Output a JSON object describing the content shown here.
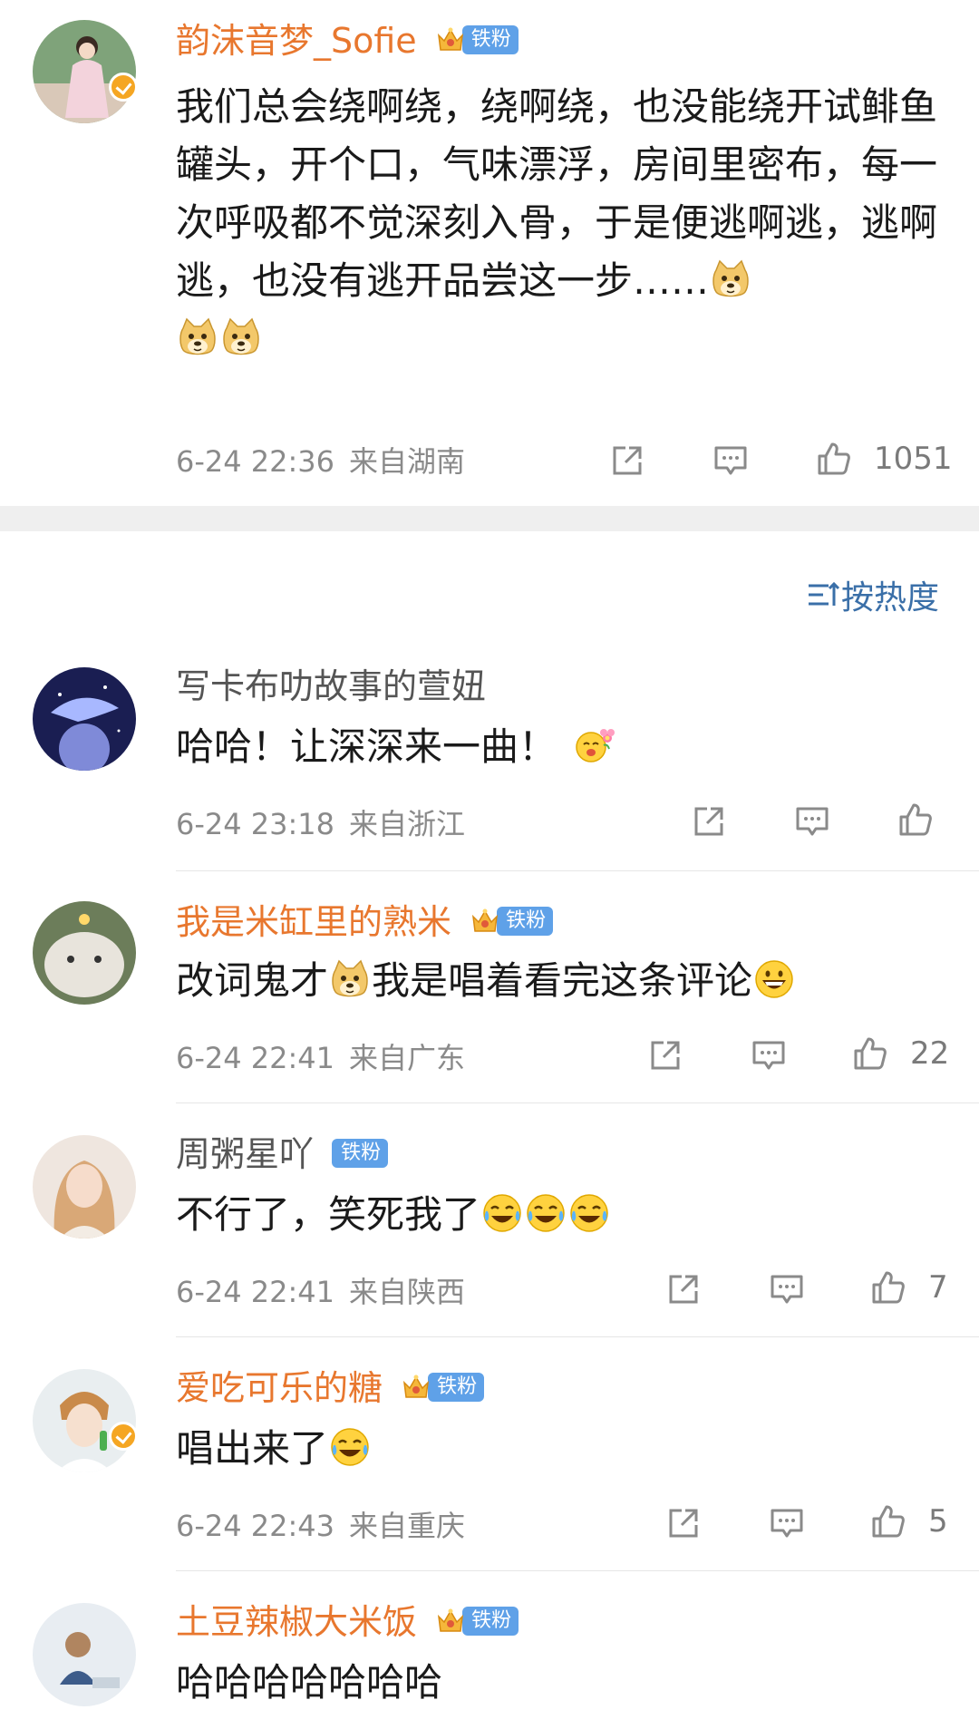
{
  "top_comment": {
    "username": "韵沫音梦_Sofie",
    "badge": "铁粉",
    "text": "我们总会绕啊绕，绕啊绕，也没能绕开试鲱鱼罐头，开个口，气味漂浮，房间里密布，每一次呼吸都不觉深刻入骨，于是便逃啊逃，逃啊逃，也没有逃开品尝这一步……",
    "time": "6-24 22:36",
    "location": "来自湖南",
    "likes": "1051"
  },
  "sort_label": "按热度",
  "replies": [
    {
      "username": "写卡布叻故事的萱妞",
      "name_color": "gray",
      "badge": "",
      "text": "哈哈！让深深来一曲！",
      "time": "6-24 23:18",
      "location": "来自浙江",
      "likes": ""
    },
    {
      "username": "我是米缸里的熟米",
      "name_color": "orange",
      "badge": "铁粉",
      "text_a": "改词鬼才",
      "text_b": "我是唱着看完这条评论",
      "time": "6-24 22:41",
      "location": "来自广东",
      "likes": "22"
    },
    {
      "username": "周粥星吖",
      "name_color": "gray",
      "badge": "铁粉",
      "text": "不行了，笑死我了",
      "time": "6-24 22:41",
      "location": "来自陕西",
      "likes": "7"
    },
    {
      "username": "爱吃可乐的糖",
      "name_color": "orange",
      "badge": "铁粉",
      "text": "唱出来了",
      "time": "6-24 22:43",
      "location": "来自重庆",
      "likes": "5"
    },
    {
      "username": "土豆辣椒大米饭",
      "name_color": "orange",
      "badge": "铁粉",
      "text": "哈哈哈哈哈哈哈",
      "time": "",
      "location": "",
      "likes": ""
    }
  ],
  "colors": {
    "username_orange": "#e8772e",
    "username_gray": "#555555",
    "fan_badge": "#5fa1e8",
    "meta_gray": "#8a8a8a",
    "sort_blue": "#3a6fa8"
  },
  "icons": [
    "share-icon",
    "comment-icon",
    "thumbs-up-icon",
    "crown-icon",
    "verified-icon",
    "doge-emoji",
    "laugh-cry-emoji",
    "grin-emoji",
    "flower-emoji"
  ]
}
